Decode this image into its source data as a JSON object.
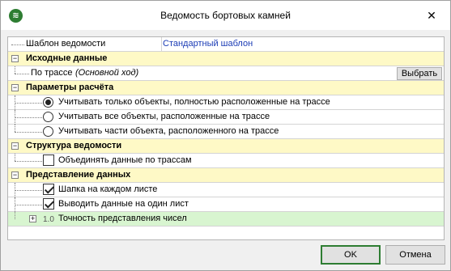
{
  "window": {
    "title": "Ведомость бортовых камней",
    "close_glyph": "✕",
    "app_icon_glyph": "≋"
  },
  "tree": {
    "template_row": {
      "label": "Шаблон ведомости",
      "value": "Стандартный шаблон"
    },
    "source": {
      "header": "Исходные данные",
      "route_label": "По трассе",
      "route_value": "(Основной ход)",
      "pick_button": "Выбрать"
    },
    "params": {
      "header": "Параметры расчёта",
      "options": [
        {
          "label": "Учитывать только объекты, полностью расположенные на трассе",
          "selected": true
        },
        {
          "label": "Учитывать все объекты, расположенные на трассе",
          "selected": false
        },
        {
          "label": "Учитывать части объекта, расположенного на трассе",
          "selected": false
        }
      ]
    },
    "structure": {
      "header": "Структура ведомости",
      "merge_label": "Объединять данные по трассам",
      "merge_checked": false
    },
    "presentation": {
      "header": "Представление данных",
      "header_each_sheet": "Шапка на каждом листе",
      "header_each_sheet_checked": true,
      "one_sheet": "Выводить данные на один лист",
      "one_sheet_checked": true,
      "precision": "Точность представления чисел",
      "precision_icon": "1.0"
    },
    "expander_minus": "−",
    "expander_plus": "+"
  },
  "buttons": {
    "ok": "OK",
    "cancel": "Отмена"
  }
}
